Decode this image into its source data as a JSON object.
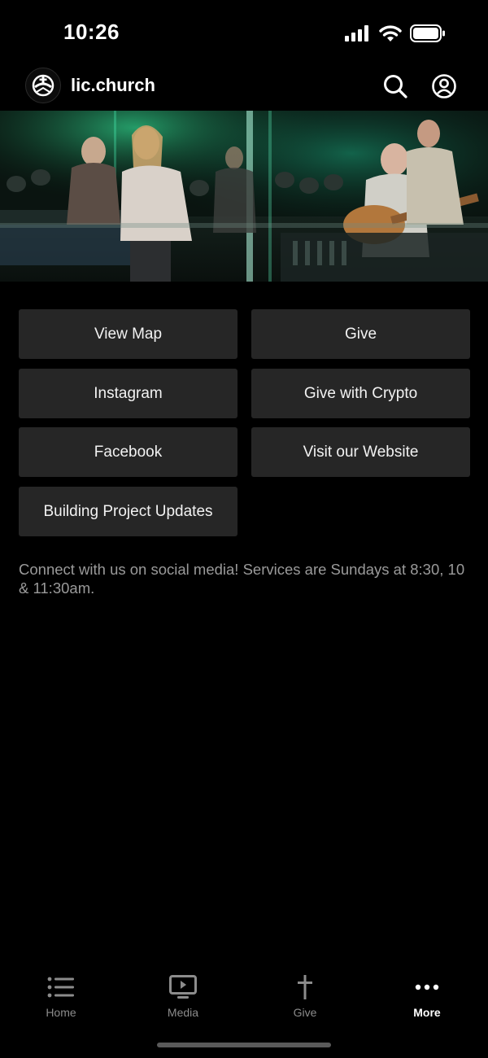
{
  "status_bar": {
    "time": "10:26",
    "icons": [
      "signal-icon",
      "wifi-icon",
      "battery-icon"
    ]
  },
  "header": {
    "title": "lic.church",
    "logo_icon": "church-logo-icon",
    "search_icon": "search-icon",
    "profile_icon": "profile-icon"
  },
  "hero": {
    "image": "worship-band-photo"
  },
  "buttons": [
    {
      "label": "View Map"
    },
    {
      "label": "Give"
    },
    {
      "label": "Instagram"
    },
    {
      "label": "Give with Crypto"
    },
    {
      "label": "Facebook"
    },
    {
      "label": "Visit our Website"
    },
    {
      "label": "Building Project Updates"
    }
  ],
  "info_text": "Connect with us on social media! Services are Sundays at 8:30, 10 & 11:30am.",
  "tabs": [
    {
      "label": "Home",
      "icon": "list-icon",
      "active": false
    },
    {
      "label": "Media",
      "icon": "media-icon",
      "active": false
    },
    {
      "label": "Give",
      "icon": "cross-icon",
      "active": false
    },
    {
      "label": "More",
      "icon": "more-icon",
      "active": true
    }
  ],
  "colors": {
    "background": "#000000",
    "button_bg": "#262626",
    "muted_text": "#9a9a9a",
    "inactive_tab": "#8c8c8c",
    "active_tab": "#ffffff"
  }
}
